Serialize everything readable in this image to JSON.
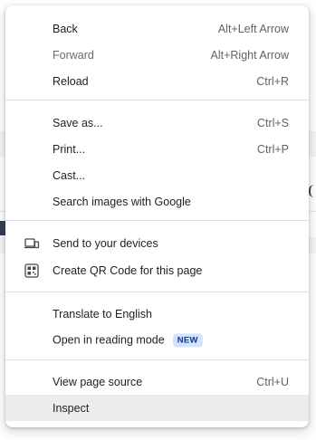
{
  "menu": {
    "back": {
      "label": "Back",
      "shortcut": "Alt+Left Arrow"
    },
    "forward": {
      "label": "Forward",
      "shortcut": "Alt+Right Arrow"
    },
    "reload": {
      "label": "Reload",
      "shortcut": "Ctrl+R"
    },
    "save_as": {
      "label": "Save as...",
      "shortcut": "Ctrl+S"
    },
    "print": {
      "label": "Print...",
      "shortcut": "Ctrl+P"
    },
    "cast": {
      "label": "Cast..."
    },
    "search_images": {
      "label": "Search images with Google"
    },
    "send_to_devices": {
      "label": "Send to your devices",
      "icon": "devices-icon"
    },
    "qr_code": {
      "label": "Create QR Code for this page",
      "icon": "qr-code-icon"
    },
    "translate": {
      "label": "Translate to English"
    },
    "reading_mode": {
      "label": "Open in reading mode",
      "badge": "NEW"
    },
    "view_source": {
      "label": "View page source",
      "shortcut": "Ctrl+U"
    },
    "inspect": {
      "label": "Inspect"
    }
  },
  "colors": {
    "separator": "#d7e1ee",
    "hover": "#ebecee",
    "badge_bg": "#d3e3fd",
    "badge_text": "#0b3c8f"
  }
}
